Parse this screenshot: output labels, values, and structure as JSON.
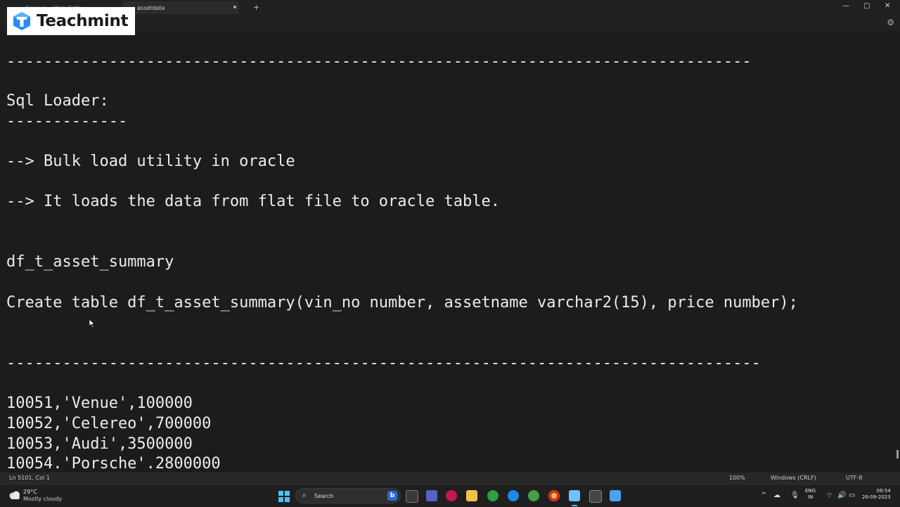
{
  "window": {
    "tabs": [
      {
        "label": "Copied... (Web Edit)"
      },
      {
        "label": "assetdata"
      }
    ],
    "new_tab_symbol": "+",
    "controls": {
      "minimize": "—",
      "maximize": "▢",
      "close": "✕"
    }
  },
  "logo": {
    "text": "Teachmint",
    "accent": "#2a8cf0"
  },
  "editor": {
    "lines": [
      "--------------------------------------------------------------------------------",
      "Sql Loader:",
      "-------------",
      "--> Bulk load utility in oracle",
      "--> It loads the data from flat file to oracle table.",
      "df_t_asset_summary",
      "Create table df_t_asset_summary(vin_no number, assetname varchar2(15), price number);",
      "---------------------------------------------------------------------------------",
      "10051,'Venue',100000",
      "10052,'Celereo',700000",
      "10053,'Audi',3500000",
      "10054.'Porsche'.2800000"
    ]
  },
  "statusbar": {
    "position": "Ln 5101, Col 1",
    "zoom": "100%",
    "line_ending": "Windows (CRLF)",
    "encoding": "UTF-8"
  },
  "taskbar": {
    "weather_temp": "29°C",
    "weather_desc": "Mostly cloudy",
    "search_placeholder": "Search",
    "lang_1": "ENG",
    "lang_2": "IN",
    "time": "08:54",
    "date": "26-09-2023",
    "tray_expand": "^"
  }
}
